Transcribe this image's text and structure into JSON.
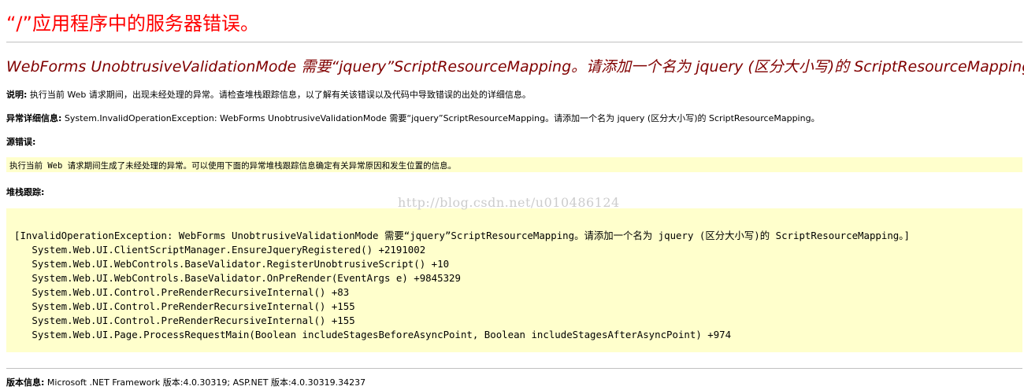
{
  "page_title": "“/”应用程序中的服务器错误。",
  "error_heading": "WebForms UnobtrusiveValidationMode 需要“jquery”ScriptResourceMapping。请添加一个名为 jquery (区分大小写)的 ScriptResourceMapping。",
  "description": {
    "label": "说明:",
    "text": " 执行当前 Web 请求期间，出现未经处理的异常。请检查堆栈跟踪信息，以了解有关该错误以及代码中导致错误的出处的详细信息。"
  },
  "exception_details": {
    "label": "异常详细信息:",
    "text": " System.InvalidOperationException: WebForms UnobtrusiveValidationMode 需要“jquery”ScriptResourceMapping。请添加一个名为 jquery (区分大小写)的 ScriptResourceMapping。"
  },
  "source_error": {
    "label": "源错误:",
    "text": "执行当前 Web 请求期间生成了未经处理的异常。可以使用下面的异常堆栈跟踪信息确定有关异常原因和发生位置的信息。"
  },
  "stack_trace": {
    "label": "堆栈跟踪:",
    "lines": [
      "[InvalidOperationException: WebForms UnobtrusiveValidationMode 需要“jquery”ScriptResourceMapping。请添加一个名为 jquery (区分大小写)的 ScriptResourceMapping。]",
      "   System.Web.UI.ClientScriptManager.EnsureJqueryRegistered() +2191002",
      "   System.Web.UI.WebControls.BaseValidator.RegisterUnobtrusiveScript() +10",
      "   System.Web.UI.WebControls.BaseValidator.OnPreRender(EventArgs e) +9845329",
      "   System.Web.UI.Control.PreRenderRecursiveInternal() +83",
      "   System.Web.UI.Control.PreRenderRecursiveInternal() +155",
      "   System.Web.UI.Control.PreRenderRecursiveInternal() +155",
      "   System.Web.UI.Page.ProcessRequestMain(Boolean includeStagesBeforeAsyncPoint, Boolean includeStagesAfterAsyncPoint) +974"
    ]
  },
  "watermark": "http://blog.csdn.net/u010486124",
  "version_info": {
    "label": "版本信息:",
    "text": " Microsoft .NET Framework 版本:4.0.30319; ASP.NET 版本:4.0.30319.34237"
  },
  "colors": {
    "title": "#ff0000",
    "heading": "#800000",
    "box_background": "#ffffcc",
    "rule": "#c0c0c0"
  }
}
